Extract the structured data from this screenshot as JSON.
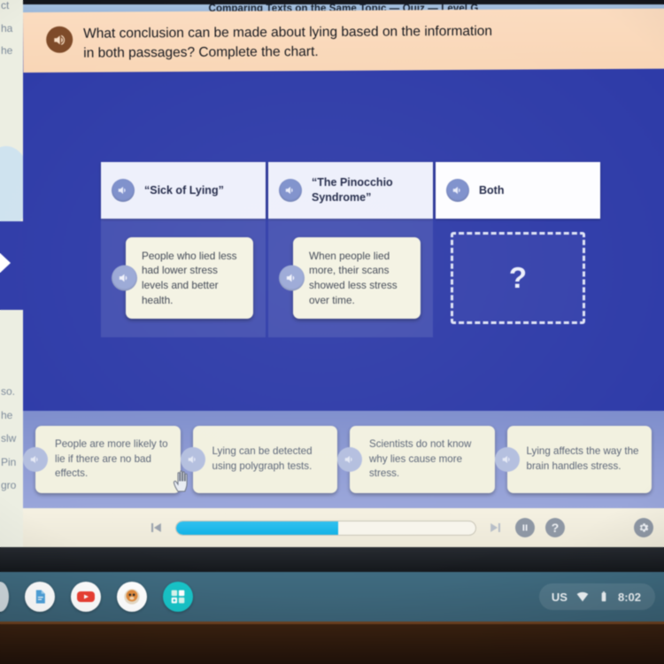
{
  "window": {
    "title": "Comparing Texts on the Same Topic — Quiz — Level G"
  },
  "question": {
    "speaker_icon": "speaker-icon",
    "text": "What conclusion can be made about lying based on the information in both passages? Complete the chart."
  },
  "chart_data": {
    "type": "table",
    "title": "Comparing Texts on the Same Topic",
    "columns": [
      {
        "header": "“Sick of Lying”",
        "cell": "People who lied less had lower stress levels and better health.",
        "filled": true
      },
      {
        "header": "“The Pinocchio Syndrome”",
        "cell": "When people lied more, their scans showed less stress over time.",
        "filled": true
      },
      {
        "header": "Both",
        "cell": "?",
        "filled": false
      }
    ]
  },
  "answer_bank": {
    "options": [
      {
        "label": "People are more likely to lie if there are no bad effects."
      },
      {
        "label": "Lying can be detected using polygraph tests."
      },
      {
        "label": "Scientists do not know why lies cause more stress."
      },
      {
        "label": "Lying affects the way the brain handles stress."
      }
    ]
  },
  "player": {
    "prev_icon": "skip-previous-icon",
    "next_icon": "skip-next-icon",
    "pause_icon": "pause-icon",
    "help_label": "?",
    "gear_icon": "gear-icon",
    "progress_percent": 54
  },
  "left_panel_fragments": {
    "top": [
      "ct",
      "ha",
      "he"
    ],
    "bottom": [
      "so.",
      "he",
      "slw",
      "Pin",
      "gro"
    ]
  },
  "shelf": {
    "apps": [
      {
        "name": "docs-app",
        "glyph": "📄"
      },
      {
        "name": "youtube-app",
        "glyph": "▶"
      },
      {
        "name": "profile-app",
        "glyph": "🐶"
      },
      {
        "name": "education-app",
        "glyph": "⊞"
      }
    ],
    "tray": {
      "keyboard": "US",
      "wifi_icon": "wifi-icon",
      "battery_icon": "battery-icon",
      "clock": "8:02"
    }
  },
  "colors": {
    "app_background": "#2e3ba8",
    "banner": "#fbdcc0",
    "answer_bank": "#8d9ad3",
    "card": "#f2f1e0",
    "progress_fill": "#12b2e6",
    "shelf": "#3a6073"
  }
}
